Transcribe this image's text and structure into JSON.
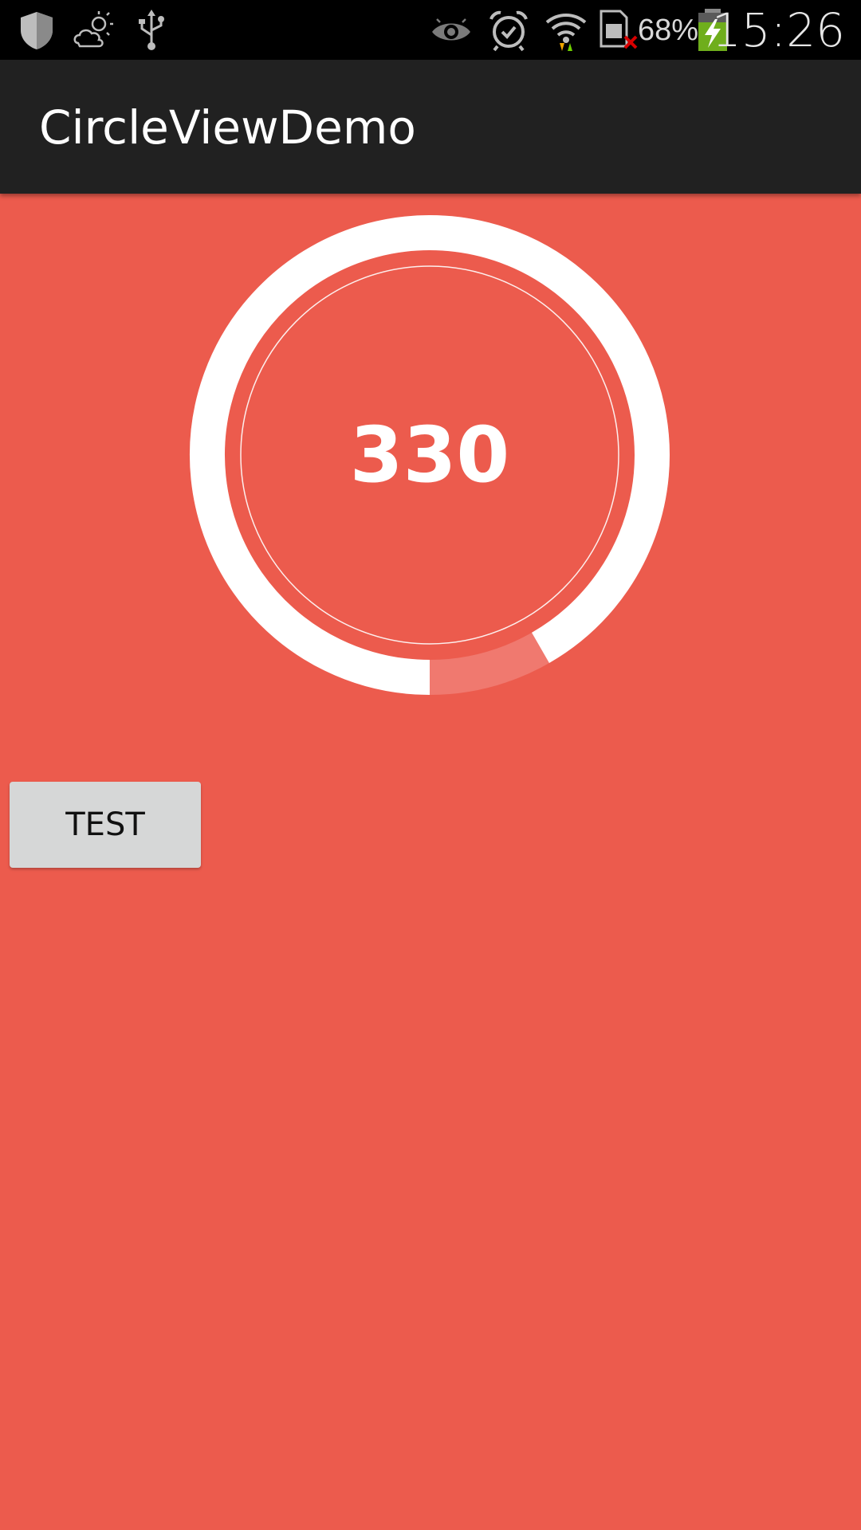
{
  "status_bar": {
    "icons_left": [
      "shield-icon",
      "partly-cloudy-icon",
      "usb-icon"
    ],
    "icons_right": [
      "eye-icon",
      "alarm-clock-icon",
      "wifi-icon",
      "sim-error-icon",
      "battery-charging-icon"
    ],
    "battery_percent": "68%",
    "time": "15:26"
  },
  "action_bar": {
    "title": "CircleViewDemo"
  },
  "circle_view": {
    "value": "330",
    "progress_fraction": 0.917,
    "ring_color": "#ffffff",
    "remaining_color": "#f0796f"
  },
  "buttons": {
    "test_label": "TEST"
  },
  "colors": {
    "background": "#ec5b4d",
    "action_bar": "#212121",
    "status_bar": "#000000",
    "button": "#d6d7d7"
  }
}
